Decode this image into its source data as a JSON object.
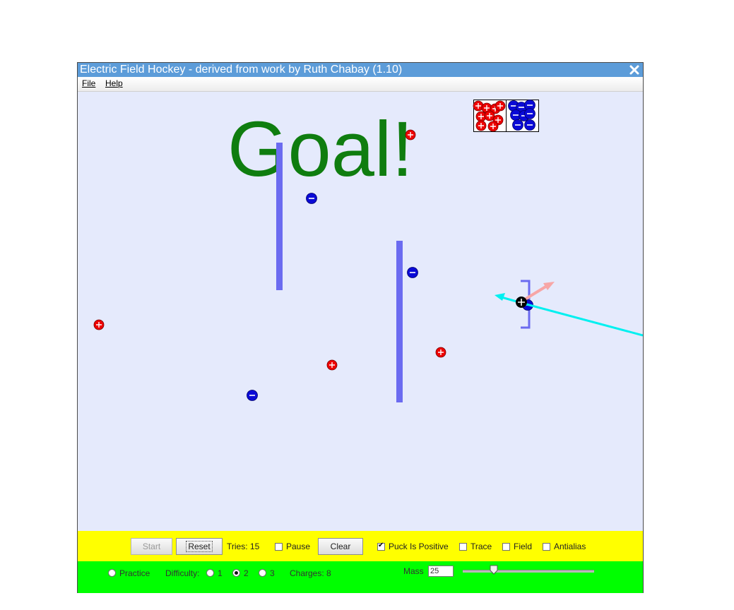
{
  "window": {
    "title": "Electric Field Hockey - derived from work by Ruth Chabay (1.10)",
    "close_icon": "close-icon"
  },
  "menu": {
    "file": "File",
    "help": "Help"
  },
  "rink": {
    "banner": "Goal!",
    "banner_color": "#0f7d0f",
    "positive_color": "#ee0000",
    "negative_color": "#0a0ad6",
    "barrier_color": "#6b6bf0",
    "puck_color": "#000000",
    "field_vector_color": "#00f0f0",
    "force_vector_color": "#f7a6a6"
  },
  "toolbar": {
    "start": "Start",
    "reset": "Reset",
    "tries": "Tries: 15",
    "pause": "Pause",
    "clear": "Clear",
    "puck_is_positive": "Puck Is Positive",
    "puck_is_positive_checked": true,
    "trace": "Trace",
    "field": "Field",
    "antialias": "Antialias"
  },
  "settings": {
    "practice": "Practice",
    "difficulty": "Difficulty:",
    "level_1": "1",
    "level_2": "2",
    "level_3": "3",
    "selected_level": "2",
    "charges": "Charges: 8",
    "mass_label": "Mass",
    "mass_value": "25"
  }
}
